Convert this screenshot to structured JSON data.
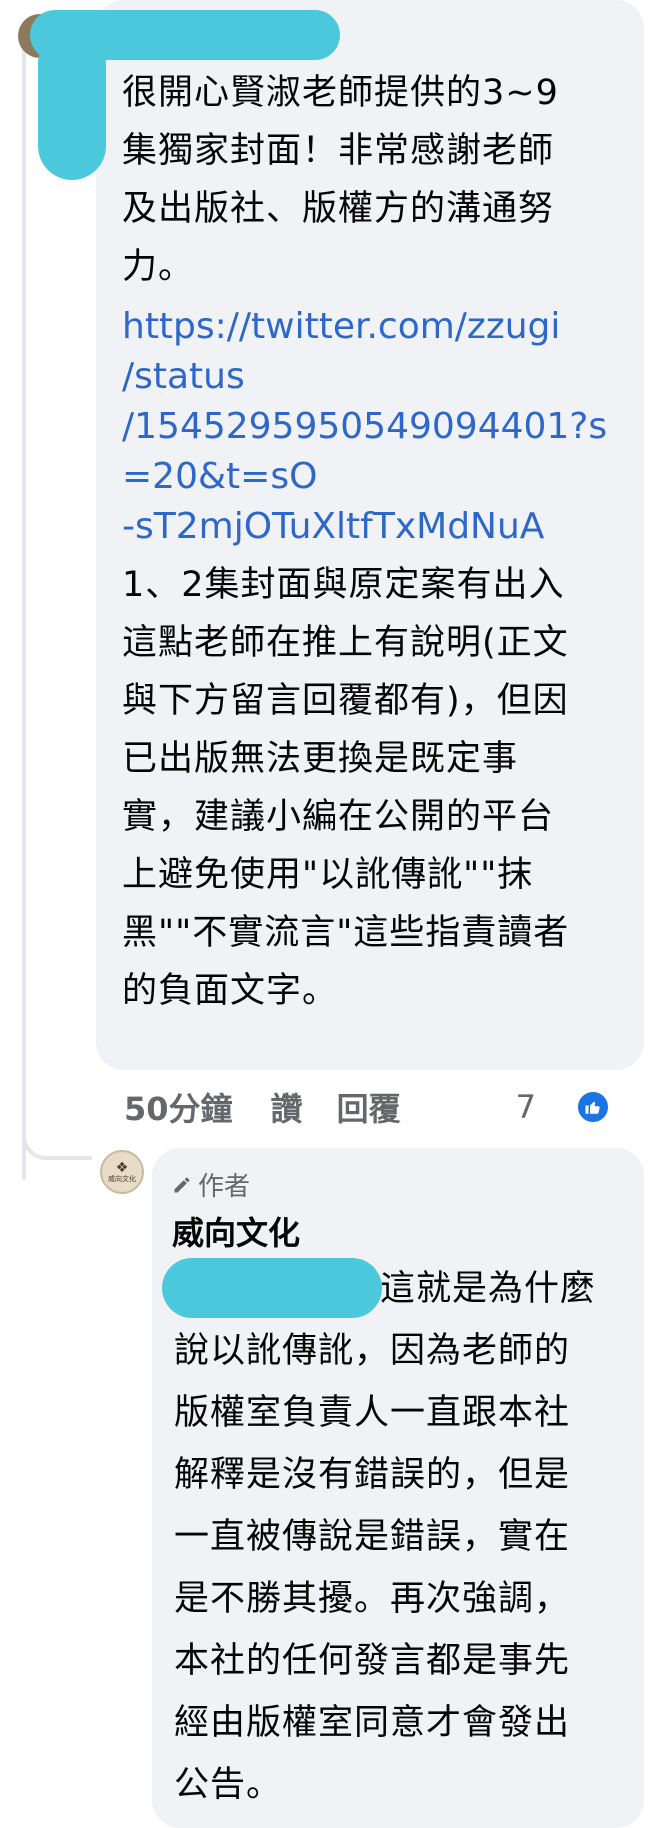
{
  "top_comment": {
    "text_before_link": "很開心賢淑老師提供的3~9\n集獨家封面！非常感謝老師\n及出版社、版權方的溝通努\n力。",
    "link": "https://twitter.com/zzugi\n/status\n/1545295950549094401?s\n=20&t=sO\n-sT2mjOTuXltfTxMdNuA",
    "text_after_link": "1、2集封面與原定案有出入\n這點老師在推上有說明(正文\n與下方留言回覆都有)，但因\n已出版無法更換是既定事\n實，建議小編在公開的平台\n上避免使用\"以訛傳訛\"\"抹\n黑\"\"不實流言\"這些指責讀者\n的負面文字。",
    "time": "50分鐘",
    "like_label": "讚",
    "reply_label": "回覆",
    "reaction_count": "7"
  },
  "reply": {
    "badge": "作者",
    "author": "威向文化",
    "avatar_text": "威向文化",
    "lines": [
      "這就是為什麼",
      "說以訛傳訛，因為老師的",
      "版權室負責人一直跟本社",
      "解釋是沒有錯誤的，但是",
      "一直被傳說是錯誤，實在",
      "是不勝其擾。再次強調，",
      "本社的任何發言都是事先",
      "經由版權室同意才會發出",
      "公告。"
    ]
  },
  "colors": {
    "bubble": "#f0f2f5",
    "link": "#2d67c9",
    "meta": "#65676b",
    "like_blue": "#1b74e4",
    "redaction": "#4cc8dc"
  }
}
